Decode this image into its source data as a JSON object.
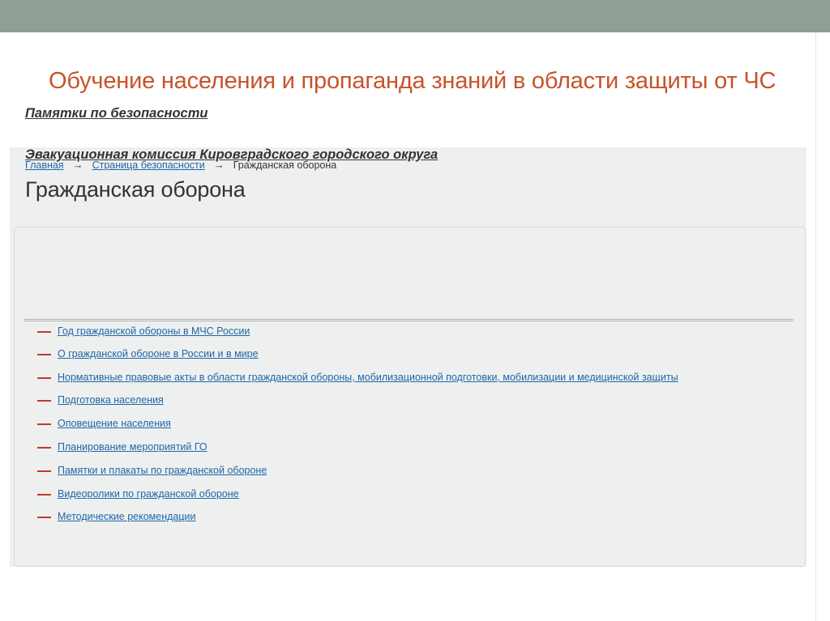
{
  "slide": {
    "title": "Обучение населения и пропаганда знаний в области защиты от ЧС"
  },
  "breadcrumb": {
    "items": [
      "Главная",
      "Страница безопасности",
      "Гражданская оборона"
    ],
    "separator": "→"
  },
  "page": {
    "heading": "Гражданская оборона"
  },
  "panel": {
    "links": [
      "Памятки по безопасности",
      "Эвакуационная комиссия Кировградского городского округа"
    ]
  },
  "sub_links": [
    "Год гражданской обороны в МЧС России",
    "О гражданской обороне в России и в мире",
    "Нормативные правовые акты в области гражданской обороны, мобилизационной подготовки, мобилизации и медицинской защиты",
    "Подготовка населения",
    "Оповещение населения",
    "Планирование мероприятий ГО",
    "Памятки и плакаты по гражданской обороне",
    "Видеоролики по гражданской обороне",
    "Методические рекомендации"
  ],
  "colors": {
    "title": "#c8532a",
    "top_bar": "#919e95",
    "link": "#2166a8",
    "bullet_dash": "#c0392b"
  }
}
